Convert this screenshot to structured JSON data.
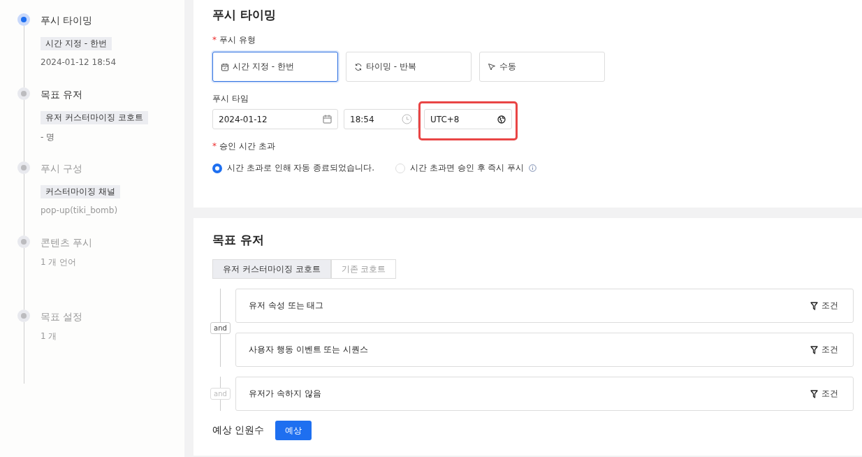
{
  "steps": [
    {
      "title": "푸시 타이밍",
      "selected": true,
      "done": true,
      "tag": "시간 지정 - 한번",
      "detail": "2024-01-12 18:54"
    },
    {
      "title": "목표 유저",
      "selected": false,
      "done": true,
      "tag": "유저 커스터마이징 코호트",
      "detail": "- 명"
    },
    {
      "title": "푸시 구성",
      "selected": false,
      "done": false,
      "tag": "커스터마이징 채널",
      "detail": "pop-up(tiki_bomb)"
    },
    {
      "title": "콘텐츠 푸시",
      "selected": false,
      "done": false,
      "detail": "1 개 언어"
    },
    {
      "title": "목표 설정",
      "selected": false,
      "done": false,
      "detail": "1 개"
    }
  ],
  "timing": {
    "title": "푸시 타이밍",
    "type_label": {
      "text": "푸시 유형",
      "mark": "*"
    },
    "types": [
      {
        "label": "시간 지정 - 한번",
        "kind": "calendar",
        "selected": true
      },
      {
        "label": "타이밍 - 반복",
        "kind": "repeat",
        "selected": false
      },
      {
        "label": "수동",
        "kind": "pointer",
        "selected": false
      }
    ],
    "time_label": {
      "text": "푸시 타임"
    },
    "date": "2024-01-12",
    "time": "18:54",
    "timezone": "UTC+8",
    "timezone_highlighted": true,
    "timeout_label": {
      "text": "승인 시간 초과",
      "mark": "*"
    },
    "timeout_options": [
      {
        "label": "시간 초과로 인해 자동 종료되었습니다.",
        "selected": true,
        "info": false
      },
      {
        "label": "시간 초과면 승인 후 즉시 푸시",
        "selected": false,
        "info": true
      }
    ]
  },
  "target": {
    "title": "목표 유저",
    "tabs": [
      {
        "label": "유저 커스터마이징 코호트",
        "selected": true
      },
      {
        "label": "기존 코호트",
        "selected": false
      }
    ],
    "groups": [
      {
        "operator": "and",
        "disabled": false,
        "conditions": [
          {
            "label": "유저 속성 또는 태그",
            "action": "조건"
          },
          {
            "label": "사용자 행동 이벤트 또는 시퀀스",
            "action": "조건"
          }
        ]
      },
      {
        "operator": "and",
        "disabled": true,
        "conditions": [
          {
            "label": "유저가 속하지 않음",
            "action": "조건"
          }
        ]
      }
    ],
    "estimate_label": "예상 인원수",
    "estimate_button": "예상"
  }
}
